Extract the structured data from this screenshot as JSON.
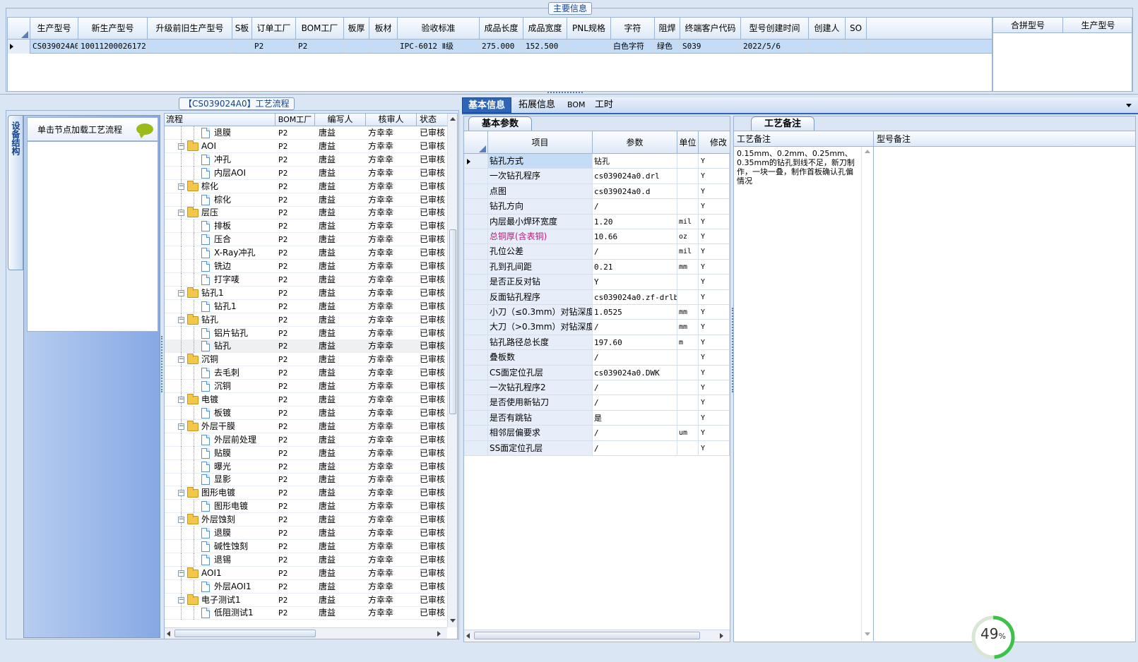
{
  "main_info": {
    "title": "主要信息",
    "columns": [
      "生产型号",
      "新生产型号",
      "升级前旧生产型号",
      "S板",
      "订单工厂",
      "BOM工厂",
      "板厚",
      "板材",
      "验收标准",
      "成品长度",
      "成品宽度",
      "PNL规格",
      "字符",
      "阻焊",
      "终端客户代码",
      "型号创建时间",
      "创建人",
      "SO"
    ],
    "row": [
      "CS039024A0",
      "10011200026172",
      "",
      "",
      "P2",
      "P2",
      "",
      "",
      "IPC-6012 Ⅱ级",
      "275.000",
      "152.500",
      "",
      "白色字符",
      "绿色",
      "S039",
      "2022/5/6",
      "",
      ""
    ],
    "merge_columns": [
      "合拼型号",
      "生产型号"
    ]
  },
  "process": {
    "title": "【CS039024A0】工艺流程",
    "side_tab": "设备结构",
    "hint": "单击节点加载工艺流程",
    "columns": [
      "流程",
      "BOM工厂",
      "编写人",
      "核审人",
      "状态"
    ],
    "rows": [
      {
        "level": 2,
        "name": "退膜",
        "bom": "P2",
        "writer": "唐益",
        "reviewer": "方幸幸",
        "status": "已审核"
      },
      {
        "level": 1,
        "name": "AOI",
        "bom": "P2",
        "writer": "唐益",
        "reviewer": "方幸幸",
        "status": "已审核"
      },
      {
        "level": 2,
        "name": "冲孔",
        "bom": "P2",
        "writer": "唐益",
        "reviewer": "方幸幸",
        "status": "已审核"
      },
      {
        "level": 2,
        "name": "内层AOI",
        "bom": "P2",
        "writer": "唐益",
        "reviewer": "方幸幸",
        "status": "已审核"
      },
      {
        "level": 1,
        "name": "棕化",
        "bom": "P2",
        "writer": "唐益",
        "reviewer": "方幸幸",
        "status": "已审核"
      },
      {
        "level": 2,
        "name": "棕化",
        "bom": "P2",
        "writer": "唐益",
        "reviewer": "方幸幸",
        "status": "已审核"
      },
      {
        "level": 1,
        "name": "层压",
        "bom": "P2",
        "writer": "唐益",
        "reviewer": "方幸幸",
        "status": "已审核"
      },
      {
        "level": 2,
        "name": "排板",
        "bom": "P2",
        "writer": "唐益",
        "reviewer": "方幸幸",
        "status": "已审核"
      },
      {
        "level": 2,
        "name": "压合",
        "bom": "P2",
        "writer": "唐益",
        "reviewer": "方幸幸",
        "status": "已审核"
      },
      {
        "level": 2,
        "name": "X-Ray冲孔",
        "bom": "P2",
        "writer": "唐益",
        "reviewer": "方幸幸",
        "status": "已审核"
      },
      {
        "level": 2,
        "name": "铣边",
        "bom": "P2",
        "writer": "唐益",
        "reviewer": "方幸幸",
        "status": "已审核"
      },
      {
        "level": 2,
        "name": "打字唛",
        "bom": "P2",
        "writer": "唐益",
        "reviewer": "方幸幸",
        "status": "已审核"
      },
      {
        "level": 1,
        "name": "钻孔1",
        "bom": "P2",
        "writer": "唐益",
        "reviewer": "方幸幸",
        "status": "已审核"
      },
      {
        "level": 2,
        "name": "钻孔1",
        "bom": "P2",
        "writer": "唐益",
        "reviewer": "方幸幸",
        "status": "已审核"
      },
      {
        "level": 1,
        "name": "钻孔",
        "bom": "P2",
        "writer": "唐益",
        "reviewer": "方幸幸",
        "status": "已审核"
      },
      {
        "level": 2,
        "name": "铝片钻孔",
        "bom": "P2",
        "writer": "唐益",
        "reviewer": "方幸幸",
        "status": "已审核"
      },
      {
        "level": 2,
        "name": "钻孔",
        "bom": "P2",
        "writer": "唐益",
        "reviewer": "方幸幸",
        "status": "已审核",
        "selected": true
      },
      {
        "level": 1,
        "name": "沉铜",
        "bom": "P2",
        "writer": "唐益",
        "reviewer": "方幸幸",
        "status": "已审核"
      },
      {
        "level": 2,
        "name": "去毛刺",
        "bom": "P2",
        "writer": "唐益",
        "reviewer": "方幸幸",
        "status": "已审核"
      },
      {
        "level": 2,
        "name": "沉铜",
        "bom": "P2",
        "writer": "唐益",
        "reviewer": "方幸幸",
        "status": "已审核"
      },
      {
        "level": 1,
        "name": "电镀",
        "bom": "P2",
        "writer": "唐益",
        "reviewer": "方幸幸",
        "status": "已审核"
      },
      {
        "level": 2,
        "name": "板镀",
        "bom": "P2",
        "writer": "唐益",
        "reviewer": "方幸幸",
        "status": "已审核"
      },
      {
        "level": 1,
        "name": "外层干膜",
        "bom": "P2",
        "writer": "唐益",
        "reviewer": "方幸幸",
        "status": "已审核"
      },
      {
        "level": 2,
        "name": "外层前处理",
        "bom": "P2",
        "writer": "唐益",
        "reviewer": "方幸幸",
        "status": "已审核"
      },
      {
        "level": 2,
        "name": "贴膜",
        "bom": "P2",
        "writer": "唐益",
        "reviewer": "方幸幸",
        "status": "已审核"
      },
      {
        "level": 2,
        "name": "曝光",
        "bom": "P2",
        "writer": "唐益",
        "reviewer": "方幸幸",
        "status": "已审核"
      },
      {
        "level": 2,
        "name": "显影",
        "bom": "P2",
        "writer": "唐益",
        "reviewer": "方幸幸",
        "status": "已审核"
      },
      {
        "level": 1,
        "name": "图形电镀",
        "bom": "P2",
        "writer": "唐益",
        "reviewer": "方幸幸",
        "status": "已审核"
      },
      {
        "level": 2,
        "name": "图形电镀",
        "bom": "P2",
        "writer": "唐益",
        "reviewer": "方幸幸",
        "status": "已审核"
      },
      {
        "level": 1,
        "name": "外层蚀刻",
        "bom": "P2",
        "writer": "唐益",
        "reviewer": "方幸幸",
        "status": "已审核"
      },
      {
        "level": 2,
        "name": "退膜",
        "bom": "P2",
        "writer": "唐益",
        "reviewer": "方幸幸",
        "status": "已审核"
      },
      {
        "level": 2,
        "name": "碱性蚀刻",
        "bom": "P2",
        "writer": "唐益",
        "reviewer": "方幸幸",
        "status": "已审核"
      },
      {
        "level": 2,
        "name": "退锡",
        "bom": "P2",
        "writer": "唐益",
        "reviewer": "方幸幸",
        "status": "已审核"
      },
      {
        "level": 1,
        "name": "AOI1",
        "bom": "P2",
        "writer": "唐益",
        "reviewer": "方幸幸",
        "status": "已审核"
      },
      {
        "level": 2,
        "name": "外层AOI1",
        "bom": "P2",
        "writer": "唐益",
        "reviewer": "方幸幸",
        "status": "已审核"
      },
      {
        "level": 1,
        "name": "电子测试1",
        "bom": "P2",
        "writer": "唐益",
        "reviewer": "方幸幸",
        "status": "已审核"
      },
      {
        "level": 2,
        "name": "低阻测试1",
        "bom": "P2",
        "writer": "唐益",
        "reviewer": "方幸幸",
        "status": "已审核"
      }
    ]
  },
  "right_tabs": [
    "基本信息",
    "拓展信息",
    "BOM",
    "工时"
  ],
  "basic_params": {
    "title": "基本参数",
    "columns": [
      "项目",
      "参数",
      "单位",
      "修改"
    ],
    "rows": [
      {
        "item": "钻孔方式",
        "value": "钻孔",
        "unit": "",
        "mod": "Y",
        "highlight": true
      },
      {
        "item": "一次钻孔程序",
        "value": "cs039024a0.drl",
        "unit": "",
        "mod": "Y"
      },
      {
        "item": "点图",
        "value": "cs039024a0.d",
        "unit": "",
        "mod": "Y"
      },
      {
        "item": "钻孔方向",
        "value": "/",
        "unit": "",
        "mod": "Y"
      },
      {
        "item": "内层最小焊环宽度",
        "value": "1.20",
        "unit": "mil",
        "mod": "Y"
      },
      {
        "item": "总铜厚(含表铜)",
        "value": "10.66",
        "unit": "oz",
        "mod": "Y",
        "red": true
      },
      {
        "item": "孔位公差",
        "value": "/",
        "unit": "mil",
        "mod": "Y"
      },
      {
        "item": "孔到孔间距",
        "value": "0.21",
        "unit": "mm",
        "mod": "Y"
      },
      {
        "item": "是否正反对钻",
        "value": "Y",
        "unit": "",
        "mod": "Y"
      },
      {
        "item": "反面钻孔程序",
        "value": "cs039024a0.zf-drlb",
        "unit": "",
        "mod": "Y"
      },
      {
        "item": "小刀（≤0.3mm）对钻深度",
        "value": "1.0525",
        "unit": "mm",
        "mod": "Y"
      },
      {
        "item": "大刀（>0.3mm）对钻深度",
        "value": "/",
        "unit": "mm",
        "mod": "Y"
      },
      {
        "item": "钻孔路径总长度",
        "value": "197.60",
        "unit": "m",
        "mod": "Y"
      },
      {
        "item": "叠板数",
        "value": "/",
        "unit": "",
        "mod": "Y"
      },
      {
        "item": "CS面定位孔层",
        "value": "cs039024a0.DWK",
        "unit": "",
        "mod": "Y"
      },
      {
        "item": "一次钻孔程序2",
        "value": "/",
        "unit": "",
        "mod": "Y"
      },
      {
        "item": "是否使用新钻刀",
        "value": "/",
        "unit": "",
        "mod": "Y"
      },
      {
        "item": "是否有跳钻",
        "value": "是",
        "unit": "",
        "mod": "Y"
      },
      {
        "item": "相邻层偏要求",
        "value": "/",
        "unit": "um",
        "mod": "Y"
      },
      {
        "item": "SS面定位孔层",
        "value": "/",
        "unit": "",
        "mod": "Y"
      }
    ]
  },
  "remarks": {
    "title": "工艺备注",
    "columns": [
      "工艺备注",
      "型号备注"
    ],
    "process_note": "0.15mm、0.2mm、0.25mm、0.35mm的钻孔到线不足，新刀制作，一块一叠，制作首板确认孔偏情况",
    "model_note": ""
  },
  "progress": {
    "value_label": "49",
    "unit": "%",
    "value": 0.49
  }
}
